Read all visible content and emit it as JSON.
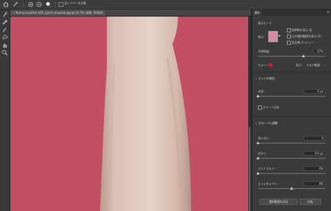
{
  "options_bar": {
    "sample_all_layers_label": "全レイヤーを対象"
  },
  "document": {
    "tab_title": "florencia-potter-cf5F_ojxcrl-unsplash.jpg @ 63.7% (背景, RGB/8)"
  },
  "panel": {
    "tab_label": "属性",
    "view_mode_header": "表示モード",
    "view_label": "表示：",
    "show_edges_label": "境界線を表示 (J)",
    "show_layers_label": "元の選択範囲を表示 (P)",
    "high_quality_preview_label": "高品質プレビュー",
    "opacity_label": "不透明度：",
    "opacity_value": "67%",
    "opacity_level": 0.67,
    "color_label": "カラー：",
    "color_hex": "#d62020",
    "display_label": "表示：",
    "display_value": "マスク範囲",
    "edge_detection_header": "エッジの検出",
    "radius_label": "半径：",
    "radius_value": "0 px",
    "radius_level": 0.0,
    "smart_radius_label": "スマート半径",
    "global_refine_header": "グローバル調整",
    "smooth_label": "滑らかに：",
    "smooth_value": "0",
    "smooth_level": 0.0,
    "feather_label": "ぼかし：",
    "feather_value": "0.0 px",
    "feather_level": 0.0,
    "contrast_label": "コントラスト：",
    "contrast_value": "0%",
    "contrast_level": 0.0,
    "shift_edge_label": "エッジをシフト：",
    "shift_edge_value": "0%",
    "shift_edge_level": 0.5,
    "clear_selection_label": "選択範囲を消去",
    "invert_label": "反転"
  }
}
